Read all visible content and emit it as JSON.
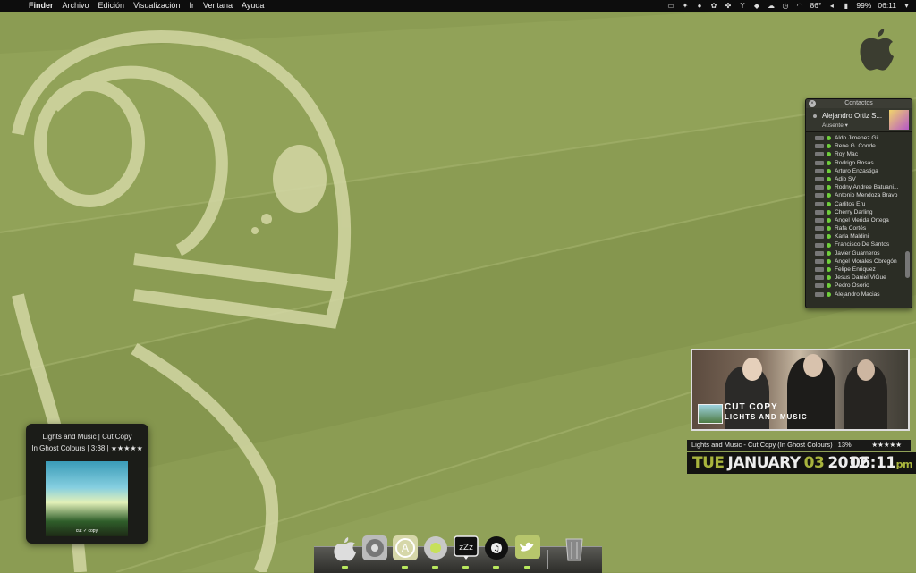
{
  "menubar": {
    "app_name": "Finder",
    "menus": [
      "Archivo",
      "Edición",
      "Visualización",
      "Ir",
      "Ventana",
      "Ayuda"
    ],
    "temperature": "86°",
    "battery": "99%",
    "clock": "06:11"
  },
  "contacts": {
    "title": "Contactos",
    "me": {
      "name": "Alejandro Ortiz S...",
      "status": "Ausente"
    },
    "list": [
      "Aldo Jimenez Gil",
      "Rene G. Conde",
      "Roy Mac",
      "Rodrigo Rosas",
      "Arturo Enzastiga",
      "Adib SV",
      "Rodny Andree Batuani...",
      "Antonio Mendoza Bravo",
      "Carlitos Eru",
      "Cherry Darling",
      "Angel Merida Ortega",
      "Rafa Cortés",
      "Karla Maldini",
      "Francisco De Santos",
      "Javier Guarneros",
      "Angel Morales Obregón",
      "Felipe Enriquez",
      "Jesus Daniel ViGue",
      "Pedro Osorio",
      "Alejandro Macias"
    ]
  },
  "album_widget": {
    "cover_text_1": "CUT COPY",
    "cover_text_2": "LIGHTS AND MUSIC"
  },
  "now_playing": {
    "text": "Lights and Music - Cut Copy (In Ghost Colours) | 13%",
    "stars": "★★★★★"
  },
  "date_display": {
    "dow": "TUE",
    "month": "JANUARY",
    "day": "03",
    "year": "2012",
    "time": "06:11",
    "ampm": "pm"
  },
  "music_widget": {
    "line1": "Lights and Music | Cut Copy",
    "line2": "In Ghost Colours | 3:38 | ★★★★★",
    "cover_caption": "cut ✓ copy"
  },
  "dock": {
    "items": [
      "finder-icon",
      "system-preferences-icon",
      "app-store-icon",
      "chrome-icon",
      "sleep-icon",
      "itunes-icon",
      "twitter-icon",
      "trash-icon"
    ]
  }
}
